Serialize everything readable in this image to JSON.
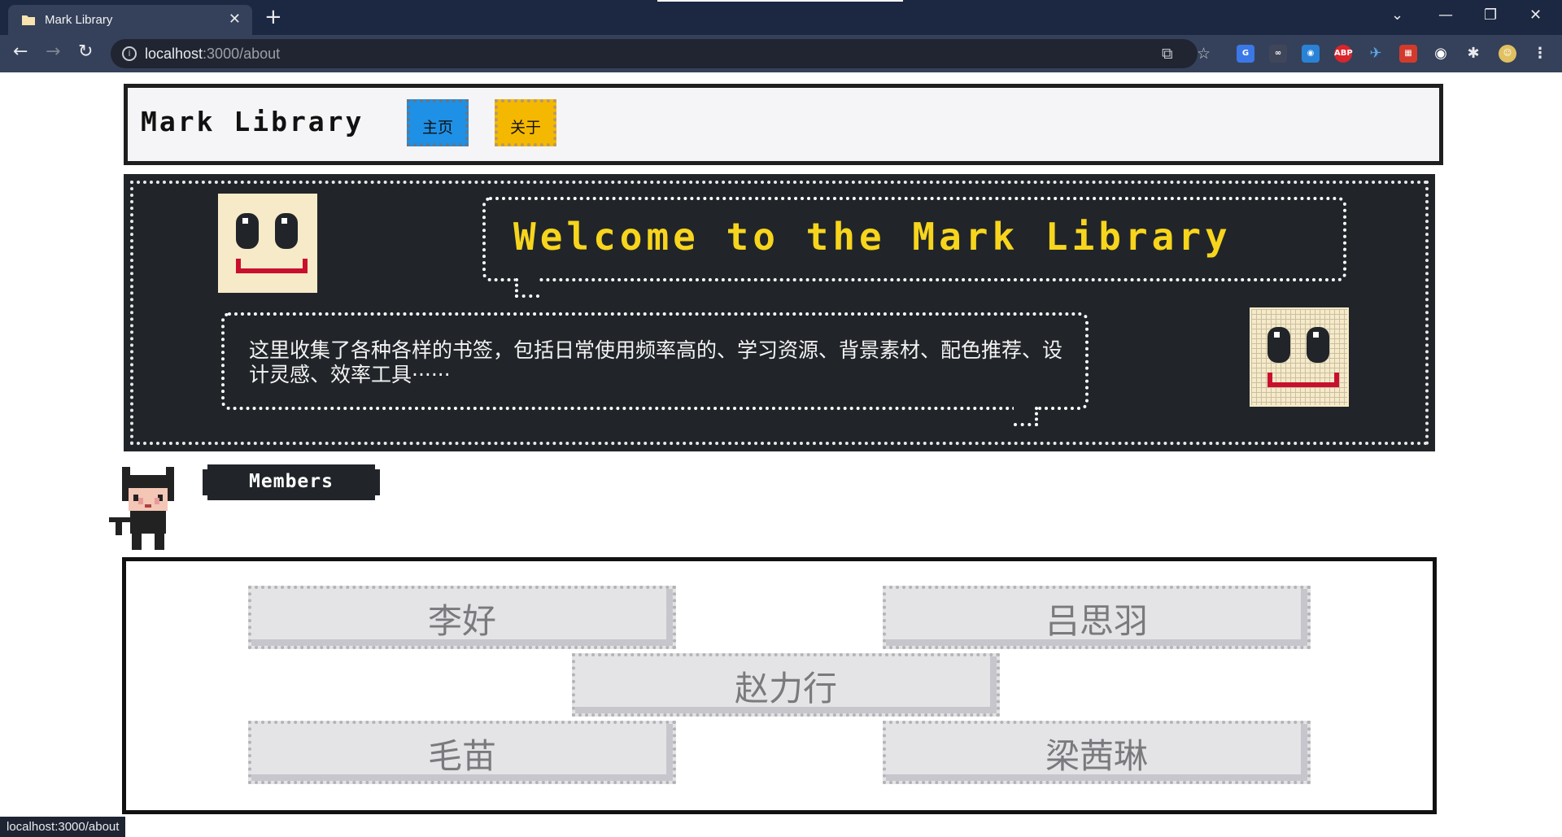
{
  "browser": {
    "tab_title": "Mark Library",
    "url_host": "localhost",
    "url_path": ":3000/about",
    "status_url": "localhost:3000/about",
    "extensions": [
      "translate-icon",
      "ghost-icon",
      "ext-icon",
      "ABP",
      "plane-icon",
      "game-icon",
      "circle-icon",
      "puzzle-icon",
      "avatar"
    ]
  },
  "nav": {
    "logo": "Mark Library",
    "home_label": "主页",
    "about_label": "关于"
  },
  "hero": {
    "welcome": "Welcome to the Mark Library",
    "description": "这里收集了各种各样的书签，包括日常使用频率高的、学习资源、背景素材、配色推荐、设计灵感、效率工具······"
  },
  "members": {
    "heading": "Members",
    "list": [
      "李好",
      "吕思羽",
      "赵力行",
      "毛苗",
      "梁茜琳"
    ]
  }
}
